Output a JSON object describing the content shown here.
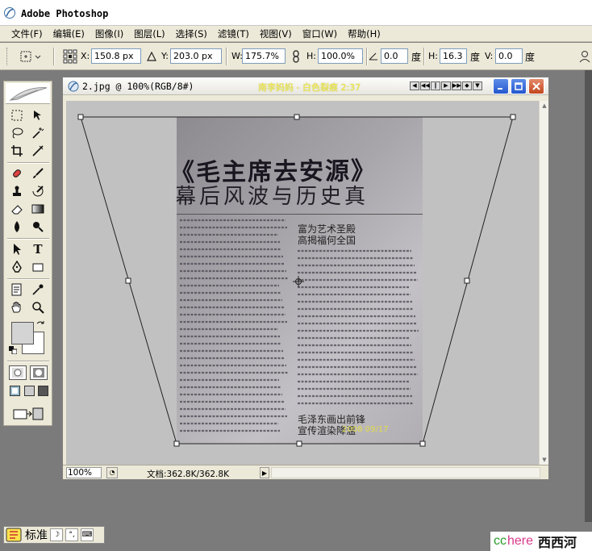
{
  "app": {
    "title": "Adobe Photoshop"
  },
  "menu": [
    {
      "label": "文件(F)"
    },
    {
      "label": "编辑(E)"
    },
    {
      "label": "图像(I)"
    },
    {
      "label": "图层(L)"
    },
    {
      "label": "选择(S)"
    },
    {
      "label": "滤镜(T)"
    },
    {
      "label": "视图(V)"
    },
    {
      "label": "窗口(W)"
    },
    {
      "label": "帮助(H)"
    }
  ],
  "options": {
    "x_label": "X:",
    "x_value": "150.8 px",
    "y_label": "Y:",
    "y_value": "203.0 px",
    "w_label": "W:",
    "w_value": "175.7%",
    "h_label": "H:",
    "h_value": "100.0%",
    "angle_value": "0.0",
    "angle_unit": "度",
    "hskew_label": "H:",
    "hskew_value": "16.3",
    "hskew_unit": "度",
    "vskew_label": "V:",
    "vskew_value": "0.0",
    "vskew_unit": "度"
  },
  "document": {
    "title": "2.jpg @ 100%(RGB/8#)",
    "watermark": "南李妈妈 - 白色裂痕  2:37",
    "zoom": "100%",
    "doc_info": "文档:362.8K/362.8K"
  },
  "photo": {
    "headline": "《毛主席去安源》",
    "subheadline": "幕后风波与历史真",
    "article_head_1": "富为艺术圣殿\n高揭福何全国",
    "article_head_2": "毛泽东画出前锋\n宣传渲染降温",
    "date_stamp": "2008 09/17"
  },
  "taskbar": {
    "ime_mode": "标准"
  },
  "brand": {
    "cc": "cc",
    "here": "here",
    "cn": "西西河"
  },
  "colors": {
    "accent": "#2557cf",
    "close": "#c2461c",
    "watermark": "#f5ef4a",
    "canvas": "#c1c1c1"
  }
}
